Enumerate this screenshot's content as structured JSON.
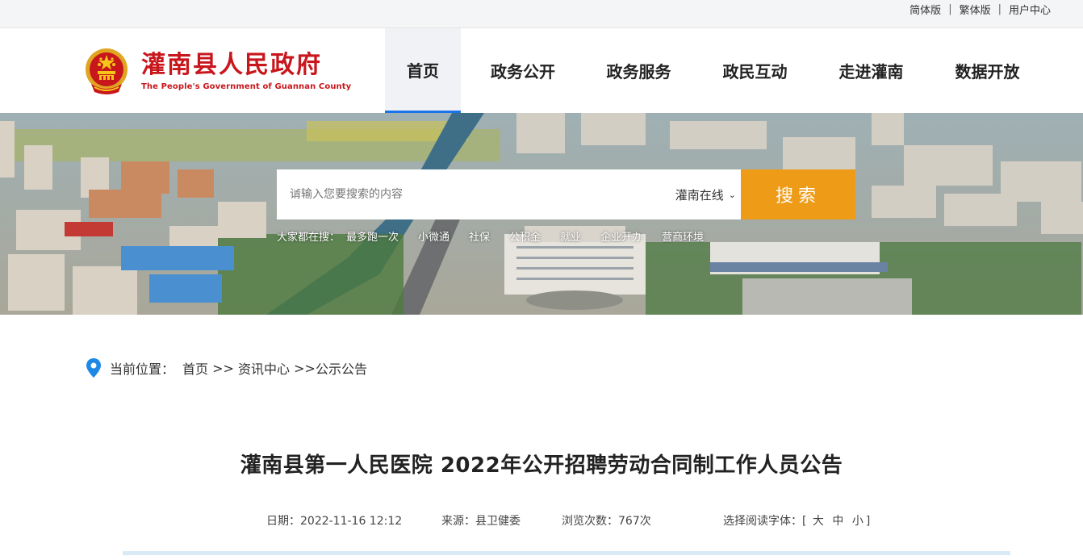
{
  "topbar": {
    "links": [
      "简体版",
      "繁体版",
      "用户中心"
    ]
  },
  "header": {
    "site_name": "灌南县人民政府",
    "site_name_en": "The People's Government of Guannan County",
    "nav": [
      {
        "label": "首页",
        "active": true
      },
      {
        "label": "政务公开",
        "active": false
      },
      {
        "label": "政务服务",
        "active": false
      },
      {
        "label": "政民互动",
        "active": false
      },
      {
        "label": "走进灌南",
        "active": false
      },
      {
        "label": "数据开放",
        "active": false
      }
    ]
  },
  "search": {
    "placeholder": "请输入您要搜索的内容",
    "scope": "灌南在线",
    "button_label": "搜索",
    "hot_label": "大家都在搜：",
    "hot_terms": [
      "最多跑一次",
      "小微通",
      "社保",
      "公积金",
      "就业",
      "企业开办",
      "营商环境"
    ]
  },
  "breadcrumb": {
    "label": "当前位置：",
    "items": [
      "首页",
      " >> ",
      "资讯中心",
      " >>",
      "公示公告"
    ]
  },
  "article": {
    "title": "灌南县第一人民医院 2022年公开招聘劳动合同制工作人员公告",
    "date": "日期：2022-11-16 12:12",
    "source": "来源：县卫健委",
    "views": "浏览次数：767次",
    "font_label": "选择阅读字体：",
    "font_open": "[",
    "font_sizes": [
      "大",
      "中",
      "小"
    ],
    "font_close": "]"
  },
  "colors": {
    "brand_red": "#c8161d",
    "search_orange": "#ee9b18",
    "nav_active_underline": "#1a73e8"
  }
}
